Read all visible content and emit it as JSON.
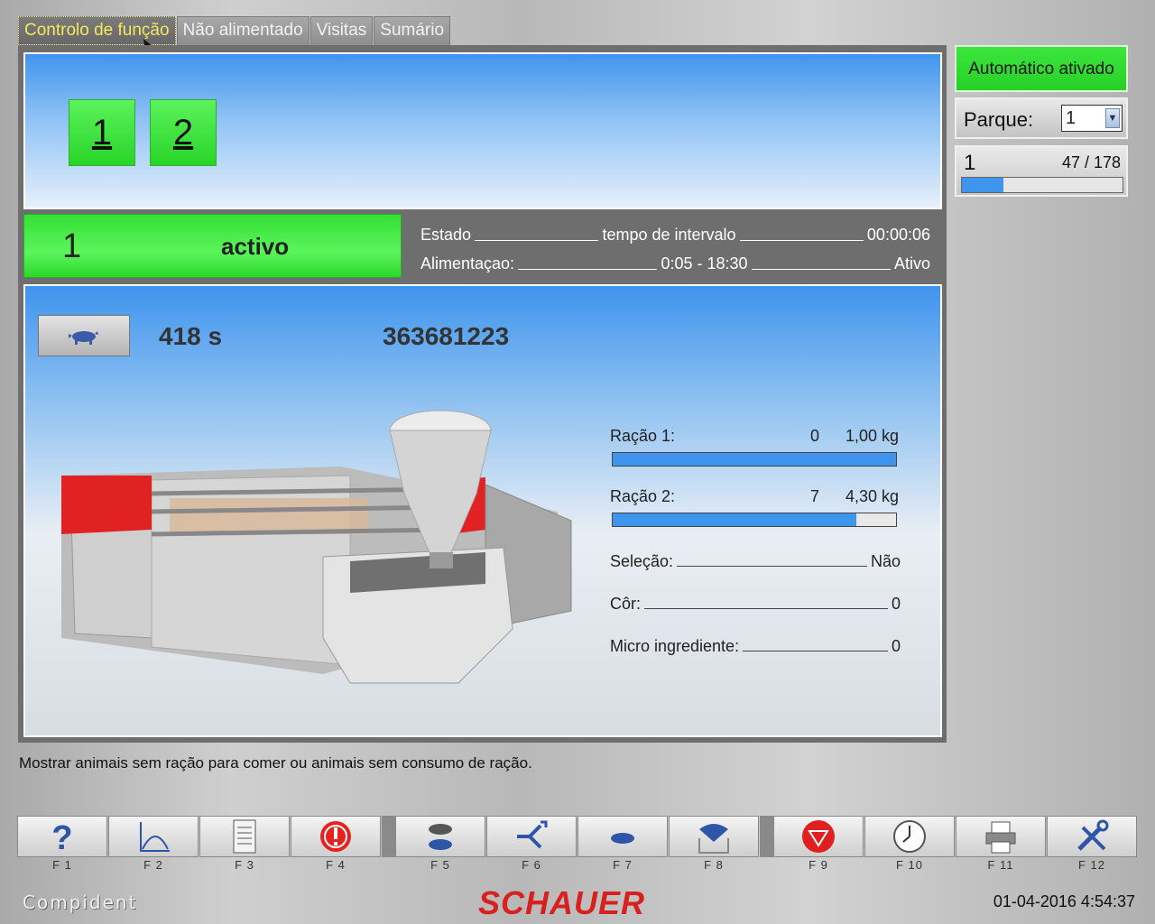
{
  "tabs": [
    "Controlo de função",
    "Não alimentado",
    "Visitas",
    "Sumário"
  ],
  "pens": [
    "1",
    "2"
  ],
  "status": {
    "number": "1",
    "text": "activo",
    "estado_label": "Estado",
    "estado_value": "tempo de intervalo",
    "estado_time": "00:00:06",
    "alim_label": "Alimentaçao:",
    "alim_value": "0:05 - 18:30",
    "alim_state": "Ativo"
  },
  "animal": {
    "time": "418 s",
    "id": "363681223"
  },
  "rations": [
    {
      "label": "Ração 1:",
      "count": "0",
      "amount": "1,00 kg",
      "fill": 1.0
    },
    {
      "label": "Ração 2:",
      "count": "7",
      "amount": "4,30 kg",
      "fill": 0.86
    }
  ],
  "details": [
    {
      "label": "Seleção:",
      "value": "Não"
    },
    {
      "label": "Côr:",
      "value": "0"
    },
    {
      "label": "Micro ingrediente:",
      "value": "0"
    }
  ],
  "hint": "Mostrar animais sem ração para comer ou animais sem consumo de ração.",
  "right": {
    "auto": "Automático ativado",
    "parque_label": "Parque:",
    "parque_value": "1",
    "count_num": "1",
    "count_frac": "47 / 178",
    "count_fill": 0.26
  },
  "fkeys": [
    {
      "label": "F 1",
      "icon": "help-icon"
    },
    {
      "label": "F 2",
      "icon": "curve-chart-icon"
    },
    {
      "label": "F 3",
      "icon": "document-icon"
    },
    {
      "label": "F 4",
      "icon": "alarm-icon"
    },
    {
      "label": "F 5",
      "icon": "pigs-icon"
    },
    {
      "label": "F 6",
      "icon": "split-arrow-icon"
    },
    {
      "label": "F 7",
      "icon": "pig-icon"
    },
    {
      "label": "F 8",
      "icon": "feeder-icon"
    },
    {
      "label": "F 9",
      "icon": "stop-icon"
    },
    {
      "label": "F 10",
      "icon": "clock-icon"
    },
    {
      "label": "F 11",
      "icon": "printer-icon"
    },
    {
      "label": "F 12",
      "icon": "tools-icon"
    }
  ],
  "footer": {
    "brand": "Compident",
    "logo": "SCHAUER",
    "datetime": "01-04-2016 4:54:37"
  }
}
